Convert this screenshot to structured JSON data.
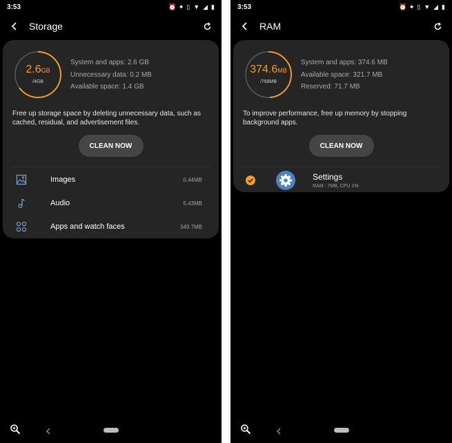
{
  "status_bar": {
    "time": "3:53"
  },
  "storage": {
    "title": "Storage",
    "ring": {
      "value": "2.6",
      "unit": "GB",
      "total": "/4GB",
      "fraction": 0.65
    },
    "stats": [
      "System and apps: 2.6 GB",
      "Unnecessary data: 0.2 MB",
      "Available space: 1.4 GB"
    ],
    "description": "Free up storage space by deleting unnecessary data, such as cached, residual, and advertisement files.",
    "clean_button": "CLEAN NOW",
    "items": [
      {
        "label": "Images",
        "size": "0.44MB",
        "icon": "image-icon"
      },
      {
        "label": "Audio",
        "size": "5.43MB",
        "icon": "music-note-icon"
      },
      {
        "label": "Apps and watch faces",
        "size": "349.7MB",
        "icon": "apps-grid-icon"
      }
    ]
  },
  "ram": {
    "title": "RAM",
    "ring": {
      "value": "374.6",
      "unit": "MB",
      "total": "/768MB",
      "fraction": 0.49
    },
    "stats": [
      "System and apps: 374.6 MB",
      "Available space: 321.7 MB",
      "Reserved: 71.7 MB"
    ],
    "description": "To improve performance, free up memory by stopping background apps.",
    "clean_button": "CLEAN NOW",
    "apps": [
      {
        "name": "Settings",
        "usage": "RAM : 7MB, CPU 1%",
        "icon": "gear-icon",
        "checked": true
      }
    ]
  },
  "colors": {
    "accent": "#f39a2c",
    "card": "#252525",
    "button": "#454545",
    "background": "#000000"
  }
}
